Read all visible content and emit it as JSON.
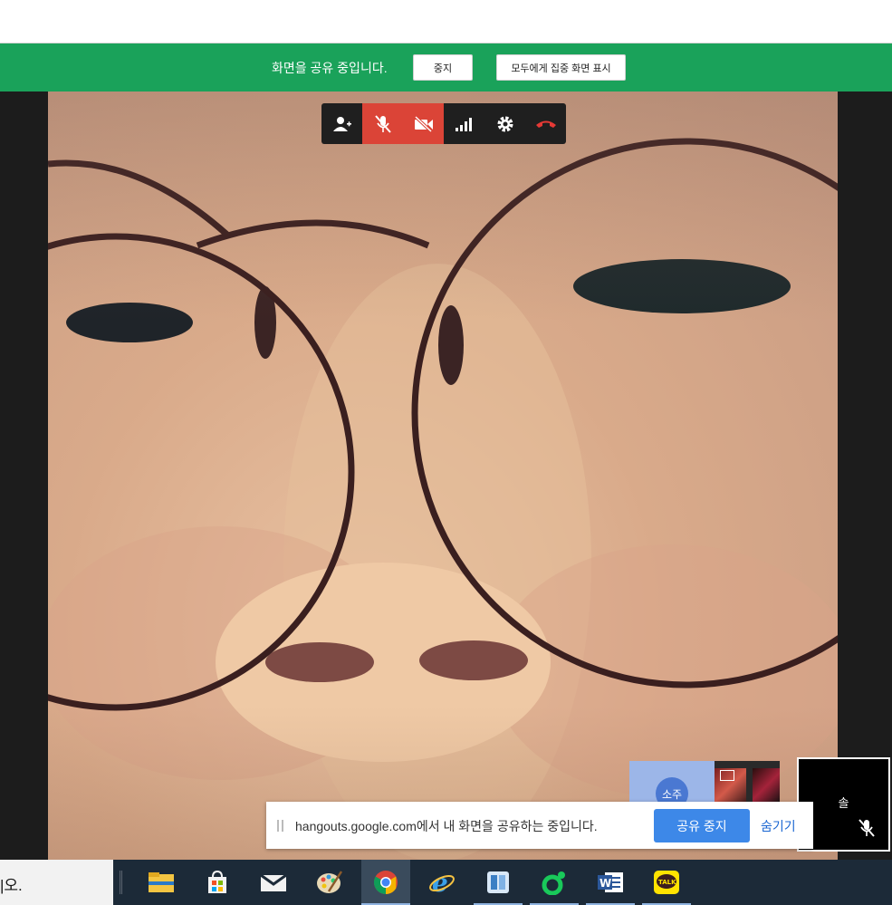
{
  "sharebar": {
    "message": "화면을 공유 중입니다.",
    "stop_label": "중지",
    "focus_label": "모두에게 집중 화면 표시"
  },
  "callbar": {
    "buttons": [
      "add-person-icon",
      "mic-off-icon",
      "camera-off-icon",
      "signal-icon",
      "gear-icon",
      "hang-up-icon"
    ]
  },
  "thumbnails": {
    "first_avatar": "소주",
    "active_name": "솔"
  },
  "notice": {
    "text": "hangouts.google.com에서 내 화면을 공유하는 중입니다.",
    "stop_label": "공유 중지",
    "hide_label": "숨기기"
  },
  "taskbar": {
    "search_text": "|오.",
    "apps": [
      "file-explorer-icon",
      "microsoft-store-icon",
      "mail-icon",
      "paint-icon",
      "chrome-icon",
      "internet-explorer-icon",
      "app-icon",
      "naver-line-icon",
      "word-icon",
      "kakaotalk-icon"
    ],
    "kakao_label": "TALK",
    "word_label": "W"
  },
  "colors": {
    "share_green": "#1aa25a",
    "call_red": "#db4437",
    "notice_blue": "#3d88e8"
  }
}
